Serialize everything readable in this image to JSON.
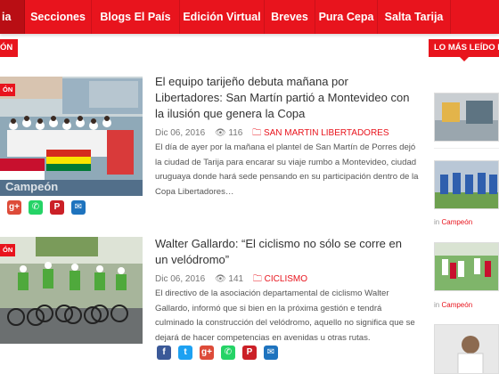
{
  "nav": {
    "items": [
      {
        "label": "Inicio"
      },
      {
        "label": "Secciones"
      },
      {
        "label": "Blogs El País"
      },
      {
        "label": "Edición Virtual"
      },
      {
        "label": "Breves"
      },
      {
        "label": "Pura Cepa"
      },
      {
        "label": "Salta Tarija"
      }
    ],
    "partial_first": "ia"
  },
  "section_label": "ÓN",
  "sidebar": {
    "title": "LO MÁS LEÍDO HOY",
    "items": [
      {
        "category_prefix": "in",
        "category": "Campeón"
      },
      {
        "category_prefix": "in",
        "category": "Campeón"
      }
    ]
  },
  "articles": [
    {
      "badge": "ÓN",
      "title": "El equipo tarijeño debuta mañana por Libertadores: San Martín partió a Montevideo con la ilusión que genera la Copa",
      "date": "Dic 06, 2016",
      "views": "116",
      "tags": "SAN MARTIN  LIBERTADORES",
      "excerpt": "El día de ayer por la mañana el plantel de San Martín de Porres dejó la ciudad de Tarija para encarar su viaje rumbo a Montevideo, ciudad uruguaya donde hará sede pensando en su participación dentro de la Copa Libertadores…",
      "image_text": "Campeón"
    },
    {
      "badge": "ÓN",
      "title": "Walter Gallardo: “El ciclismo no sólo se corre en un velódromo”",
      "date": "Dic 06, 2016",
      "views": "141",
      "tags": "CICLISMO",
      "excerpt": "El directivo de la asociación departamental de ciclismo Walter Gallardo, informó que si bien  en la próxima gestión e tendrá culminado la construcción del velódromo, aquello no significa que se dejará de hacer competencias  en avenidas u otras rutas."
    }
  ],
  "share_icons": [
    "facebook-icon",
    "twitter-icon",
    "google-plus-icon",
    "whatsapp-icon",
    "pinterest-icon",
    "email-icon"
  ],
  "colors": {
    "brand_red": "#e8141d",
    "facebook": "#3b5998",
    "twitter": "#1da1f2",
    "google_plus": "#dd4b39",
    "whatsapp": "#25d366",
    "pinterest": "#cb2027",
    "email": "#1e73be"
  }
}
